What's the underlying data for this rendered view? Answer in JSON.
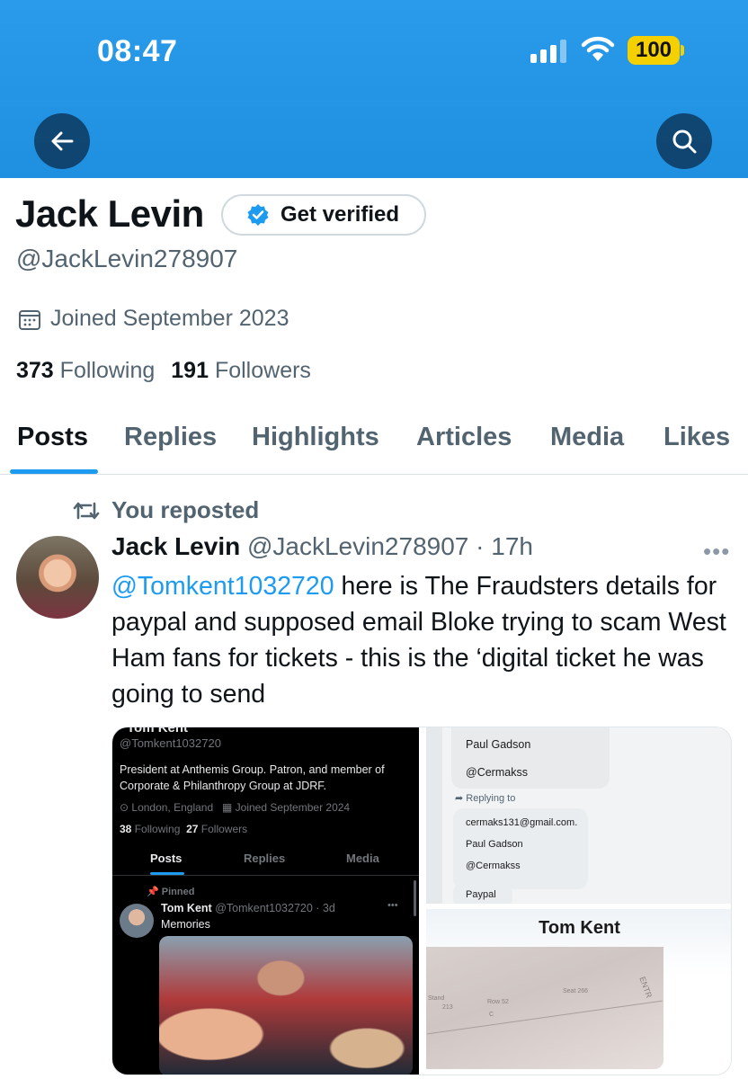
{
  "status_bar": {
    "time": "08:47",
    "battery": "100"
  },
  "profile": {
    "name": "Jack Levin",
    "verify_label": "Get verified",
    "handle": "@JackLevin278907",
    "joined": "Joined September 2023",
    "following_count": "373",
    "following_label": "Following",
    "followers_count": "191",
    "followers_label": "Followers"
  },
  "tabs": [
    "Posts",
    "Replies",
    "Highlights",
    "Articles",
    "Media",
    "Likes"
  ],
  "post": {
    "repost_label": "You reposted",
    "author_name": "Jack Levin",
    "author_handle": "@JackLevin278907",
    "time": "· 17h",
    "more": "•••",
    "mention": "@Tomkent1032720",
    "text": " here is The Fraudsters details for paypal and supposed email  Bloke trying to scam West Ham fans for tickets - this is the ‘digital ticket he was going to send"
  },
  "media": {
    "ss1": {
      "top_name": "Tom Kent",
      "handle": "@Tomkent1032720",
      "bio_line1": "President at Anthemis Group. Patron, and member of",
      "bio_line2": "Corporate & Philanthropy Group at JDRF.",
      "location": "London, England",
      "joined": "Joined September 2024",
      "following_count": "38",
      "following_label": "Following",
      "followers_count": "27",
      "followers_label": "Followers",
      "tabs": [
        "Posts",
        "Replies",
        "Media"
      ],
      "pinned": "Pinned",
      "post_name": "Tom Kent",
      "post_meta": "@Tomkent1032720 · 3d",
      "post_text": "Memories",
      "post_more": "•••"
    },
    "ss2": {
      "name1": "Paul Gadson",
      "handle1": "@Cermakss",
      "replying": "Replying to",
      "email": "cermaks131@gmail.com.",
      "name2": "Paul Gadson",
      "handle2": "@Cermakss",
      "paypal": "Paypal"
    },
    "ss3": {
      "name": "Tom Kent",
      "ticket_stand": "Stand",
      "ticket_row_label": "Row",
      "ticket_row": "52",
      "ticket_seat_label": "Seat",
      "ticket_seat": "266",
      "ticket_block": "213",
      "ticket_gate": "C",
      "ticket_side": "ENTR"
    }
  },
  "colors": {
    "accent": "#1d9bf0",
    "banner": "#1f8fe0",
    "battery": "#f5d000"
  }
}
